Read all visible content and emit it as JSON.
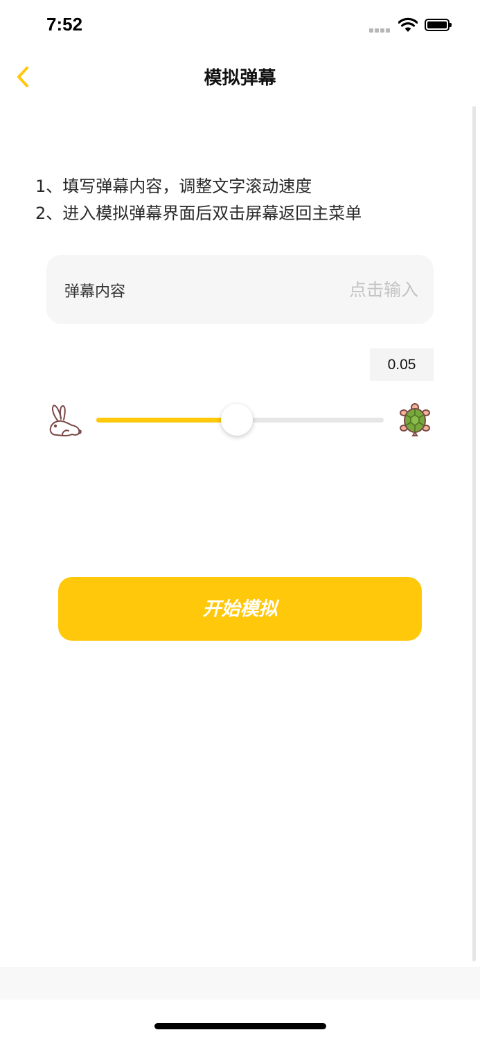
{
  "status": {
    "time": "7:52"
  },
  "nav": {
    "title": "模拟弹幕",
    "accent_color": "#ffc80a"
  },
  "instructions": [
    "1、填写弹幕内容，调整文字滚动速度",
    "2、进入模拟弹幕界面后双击屏幕返回主菜单"
  ],
  "content_input": {
    "label": "弹幕内容",
    "placeholder": "点击输入",
    "value": ""
  },
  "speed": {
    "display": "0.05",
    "slider_fraction": 0.49,
    "fast_icon": "rabbit-icon",
    "slow_icon": "turtle-icon"
  },
  "start_button": {
    "label": "开始模拟"
  }
}
